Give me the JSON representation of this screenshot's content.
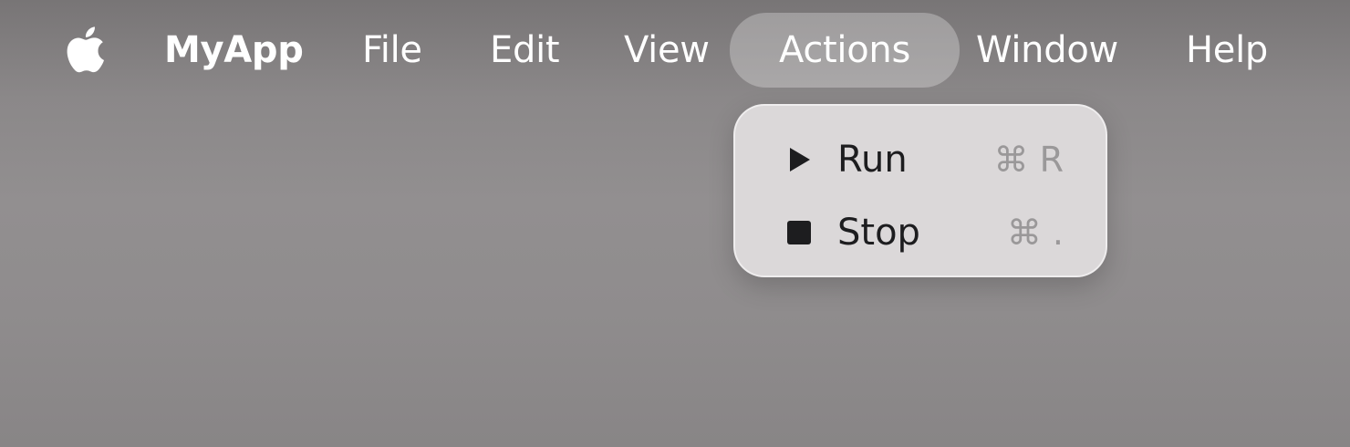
{
  "menubar": {
    "app_name": "MyApp",
    "items": [
      {
        "label": "File"
      },
      {
        "label": "Edit"
      },
      {
        "label": "View"
      },
      {
        "label": "Actions",
        "active": true
      },
      {
        "label": "Window"
      },
      {
        "label": "Help"
      }
    ]
  },
  "dropdown": {
    "items": [
      {
        "icon": "play-icon",
        "label": "Run",
        "shortcut": "⌘ R"
      },
      {
        "icon": "stop-icon",
        "label": "Stop",
        "shortcut": "⌘ ."
      }
    ]
  },
  "colors": {
    "menu_text": "#ffffff",
    "dropdown_bg": "#dbd8d9",
    "dropdown_text": "#1d1d1f",
    "shortcut_text": "#9a9899"
  }
}
